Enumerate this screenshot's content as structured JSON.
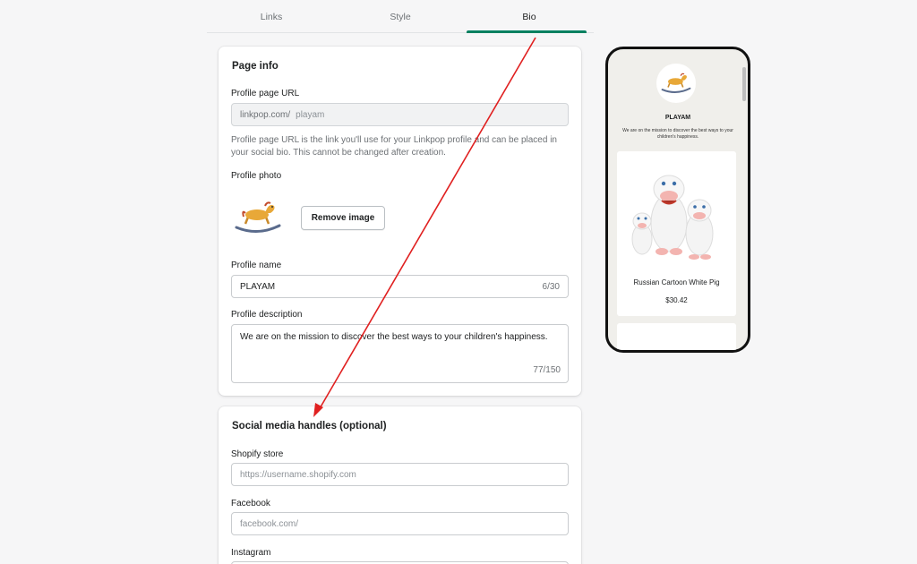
{
  "tabs": [
    {
      "label": "Links"
    },
    {
      "label": "Style"
    },
    {
      "label": "Bio"
    }
  ],
  "page_info": {
    "title": "Page info",
    "url_label": "Profile page URL",
    "url_prefix": "linkpop.com/",
    "url_value": "playam",
    "url_help": "Profile page URL is the link you'll use for your Linkpop profile and can be placed in your social bio. This cannot be changed after creation.",
    "photo_label": "Profile photo",
    "remove_image_label": "Remove image",
    "name_label": "Profile name",
    "name_value": "PLAYAM",
    "name_counter": "6/30",
    "desc_label": "Profile description",
    "desc_value": "We are on the mission to discover the best ways to your children's happiness.",
    "desc_counter": "77/150"
  },
  "social": {
    "title": "Social media handles (optional)",
    "shopify_label": "Shopify store",
    "shopify_placeholder": "https://username.shopify.com",
    "facebook_label": "Facebook",
    "facebook_placeholder": "facebook.com/",
    "instagram_label": "Instagram"
  },
  "preview": {
    "name": "PLAYAM",
    "description": "We are on the mission to discover the best ways to your children's happiness.",
    "product_title": "Russian Cartoon White Pig",
    "product_price": "$30.42"
  },
  "colors": {
    "accent": "#008060",
    "arrow": "#e02020"
  }
}
